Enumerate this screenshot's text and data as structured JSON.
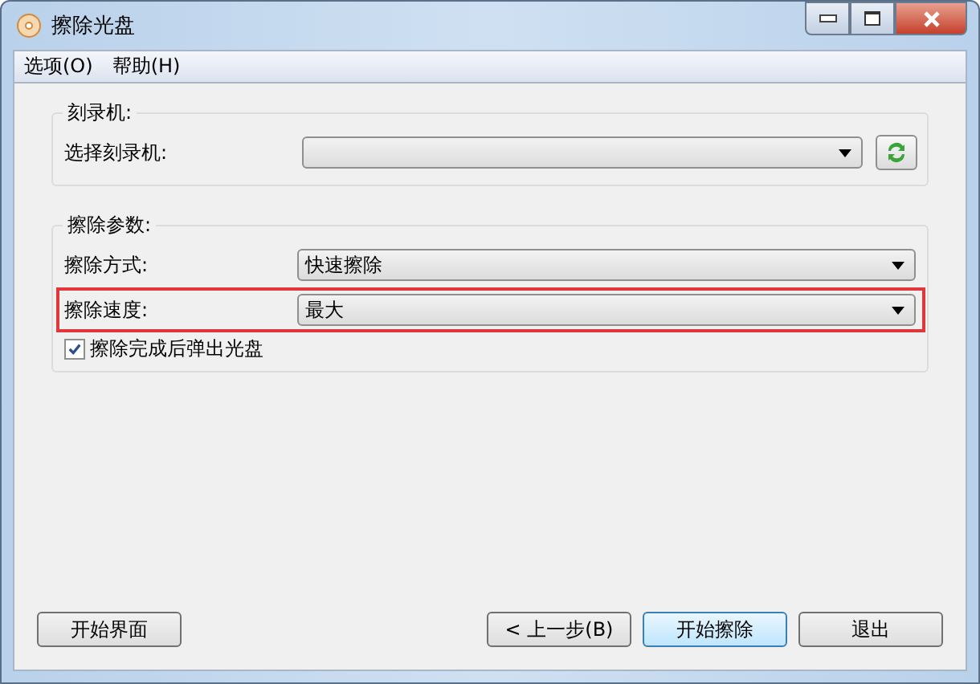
{
  "window": {
    "title": "擦除光盘"
  },
  "menu": [
    "选项(O)",
    "帮助(H)"
  ],
  "recorder_group": {
    "title": "刻录机:",
    "label": "选择刻录机:"
  },
  "params_group": {
    "title": "擦除参数:",
    "rows": [
      {
        "label": "擦除方式:",
        "value": "快速擦除",
        "highlighted": false
      },
      {
        "label": "擦除速度:",
        "value": "最大",
        "highlighted": true
      }
    ],
    "eject": {
      "label": "擦除完成后弹出光盘",
      "checked": true
    }
  },
  "buttons": [
    {
      "label": "开始界面",
      "default": false
    },
    {
      "label": "< 上一步(B)",
      "default": false
    },
    {
      "label": "开始擦除",
      "default": true
    },
    {
      "label": "退出",
      "default": false
    }
  ]
}
